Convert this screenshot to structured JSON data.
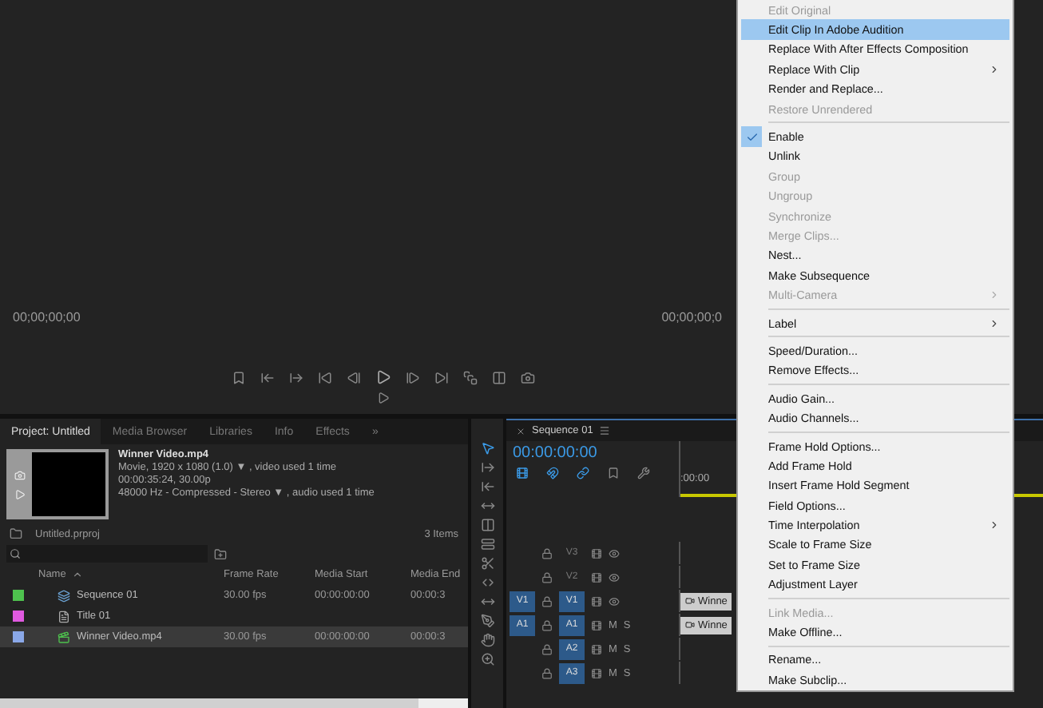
{
  "program_monitor": {
    "timecode_left": "00;00;00;00",
    "timecode_right": "00;00;00;0"
  },
  "project_panel": {
    "tabs": [
      {
        "label": "Project: Untitled",
        "selected": true
      },
      {
        "label": "Media Browser",
        "selected": false
      },
      {
        "label": "Libraries",
        "selected": false
      },
      {
        "label": "Info",
        "selected": false
      },
      {
        "label": "Effects",
        "selected": false
      }
    ],
    "overflow": "»",
    "clip_info": {
      "name": "Winner Video.mp4",
      "line_1": "Movie, 1920 x 1080 (1.0) ▼ , video used 1 time",
      "line_2": "00:00:35:24, 30.00p",
      "line_3": "48000 Hz - Compressed - Stereo ▼ , audio used 1 time"
    },
    "project_file": "Untitled.prproj",
    "item_count": "3 Items",
    "columns": [
      "Name",
      "Frame Rate",
      "Media Start",
      "Media End"
    ],
    "rows": [
      {
        "kind": "sequence",
        "color": "#4ec24e",
        "name": "Sequence 01",
        "frame_rate": "30.00 fps",
        "media_start": "00:00:00:00",
        "media_end": "00:00:3",
        "selected": false
      },
      {
        "kind": "title",
        "color": "#e05ae0",
        "name": "Title 01",
        "selected": false
      },
      {
        "kind": "video",
        "color": "#8aa8e8",
        "name": "Winner Video.mp4",
        "frame_rate": "30.00 fps",
        "media_start": "00:00:00:00",
        "media_end": "00:00:3",
        "selected": true
      }
    ]
  },
  "timeline": {
    "tab": "Sequence 01",
    "timecode": "00:00:00:00",
    "ruler": ":00:00",
    "tracks": [
      {
        "kind": "video",
        "name": "V3",
        "targeted": false
      },
      {
        "kind": "video",
        "name": "V2",
        "targeted": false
      },
      {
        "kind": "video",
        "source": "V1",
        "name": "V1",
        "targeted": true,
        "clip": "Winne"
      },
      {
        "kind": "audio",
        "source": "A1",
        "name": "A1",
        "targeted": true,
        "clip": "Winne",
        "mute": "M",
        "solo": "S"
      },
      {
        "kind": "audio",
        "name": "A2",
        "targeted": true,
        "mute": "M",
        "solo": "S"
      },
      {
        "kind": "audio",
        "name": "A3",
        "targeted": true,
        "mute": "M",
        "solo": "S"
      }
    ]
  },
  "context_menu": [
    {
      "kind": "item",
      "label": "Edit Original",
      "disabled": true,
      "checked": false,
      "submenu": false,
      "selected": false
    },
    {
      "kind": "item",
      "label": "Edit Clip In Adobe Audition",
      "disabled": false,
      "checked": false,
      "submenu": false,
      "selected": true
    },
    {
      "kind": "item",
      "label": "Replace With After Effects Composition",
      "disabled": false,
      "checked": false,
      "submenu": false,
      "selected": false
    },
    {
      "kind": "item",
      "label": "Replace With Clip",
      "disabled": false,
      "checked": false,
      "submenu": true,
      "selected": false
    },
    {
      "kind": "item",
      "label": "Render and Replace...",
      "disabled": false,
      "checked": false,
      "submenu": false,
      "selected": false
    },
    {
      "kind": "item",
      "label": "Restore Unrendered",
      "disabled": true,
      "checked": false,
      "submenu": false,
      "selected": false
    },
    {
      "kind": "separator"
    },
    {
      "kind": "item",
      "label": "Enable",
      "disabled": false,
      "checked": true,
      "submenu": false,
      "selected": false
    },
    {
      "kind": "item",
      "label": "Unlink",
      "disabled": false,
      "checked": false,
      "submenu": false,
      "selected": false
    },
    {
      "kind": "item",
      "label": "Group",
      "disabled": true,
      "checked": false,
      "submenu": false,
      "selected": false
    },
    {
      "kind": "item",
      "label": "Ungroup",
      "disabled": true,
      "checked": false,
      "submenu": false,
      "selected": false
    },
    {
      "kind": "item",
      "label": "Synchronize",
      "disabled": true,
      "checked": false,
      "submenu": false,
      "selected": false
    },
    {
      "kind": "item",
      "label": "Merge Clips...",
      "disabled": true,
      "checked": false,
      "submenu": false,
      "selected": false
    },
    {
      "kind": "item",
      "label": "Nest...",
      "disabled": false,
      "checked": false,
      "submenu": false,
      "selected": false
    },
    {
      "kind": "item",
      "label": "Make Subsequence",
      "disabled": false,
      "checked": false,
      "submenu": false,
      "selected": false
    },
    {
      "kind": "item",
      "label": "Multi-Camera",
      "disabled": true,
      "checked": false,
      "submenu": true,
      "selected": false
    },
    {
      "kind": "separator"
    },
    {
      "kind": "item",
      "label": "Label",
      "disabled": false,
      "checked": false,
      "submenu": true,
      "selected": false
    },
    {
      "kind": "separator"
    },
    {
      "kind": "item",
      "label": "Speed/Duration...",
      "disabled": false,
      "checked": false,
      "submenu": false,
      "selected": false
    },
    {
      "kind": "item",
      "label": "Remove Effects...",
      "disabled": false,
      "checked": false,
      "submenu": false,
      "selected": false
    },
    {
      "kind": "separator"
    },
    {
      "kind": "item",
      "label": "Audio Gain...",
      "disabled": false,
      "checked": false,
      "submenu": false,
      "selected": false
    },
    {
      "kind": "item",
      "label": "Audio Channels...",
      "disabled": false,
      "checked": false,
      "submenu": false,
      "selected": false
    },
    {
      "kind": "separator"
    },
    {
      "kind": "item",
      "label": "Frame Hold Options...",
      "disabled": false,
      "checked": false,
      "submenu": false,
      "selected": false
    },
    {
      "kind": "item",
      "label": "Add Frame Hold",
      "disabled": false,
      "checked": false,
      "submenu": false,
      "selected": false
    },
    {
      "kind": "item",
      "label": "Insert Frame Hold Segment",
      "disabled": false,
      "checked": false,
      "submenu": false,
      "selected": false
    },
    {
      "kind": "item",
      "label": "Field Options...",
      "disabled": false,
      "checked": false,
      "submenu": false,
      "selected": false
    },
    {
      "kind": "item",
      "label": "Time Interpolation",
      "disabled": false,
      "checked": false,
      "submenu": true,
      "selected": false
    },
    {
      "kind": "item",
      "label": "Scale to Frame Size",
      "disabled": false,
      "checked": false,
      "submenu": false,
      "selected": false
    },
    {
      "kind": "item",
      "label": "Set to Frame Size",
      "disabled": false,
      "checked": false,
      "submenu": false,
      "selected": false
    },
    {
      "kind": "item",
      "label": "Adjustment Layer",
      "disabled": false,
      "checked": false,
      "submenu": false,
      "selected": false
    },
    {
      "kind": "separator"
    },
    {
      "kind": "item",
      "label": "Link Media...",
      "disabled": true,
      "checked": false,
      "submenu": false,
      "selected": false
    },
    {
      "kind": "item",
      "label": "Make Offline...",
      "disabled": false,
      "checked": false,
      "submenu": false,
      "selected": false
    },
    {
      "kind": "separator"
    },
    {
      "kind": "item",
      "label": "Rename...",
      "disabled": false,
      "checked": false,
      "submenu": false,
      "selected": false
    },
    {
      "kind": "item",
      "label": "Make Subclip...",
      "disabled": false,
      "checked": false,
      "submenu": false,
      "selected": false
    }
  ]
}
